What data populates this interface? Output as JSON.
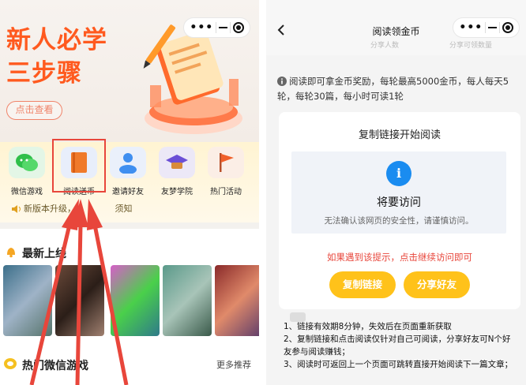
{
  "left": {
    "banner": {
      "title_line1": "新人必学",
      "title_line2": "三步骤",
      "button_label": "点击查看"
    },
    "capsule": {
      "more": "•••"
    },
    "menu": [
      {
        "label": "微信游戏",
        "icon": "wechat-icon"
      },
      {
        "label": "阅读送币",
        "icon": "book-icon"
      },
      {
        "label": "邀请好友",
        "icon": "person-icon"
      },
      {
        "label": "友梦学院",
        "icon": "graduation-cap-icon"
      },
      {
        "label": "热门活动",
        "icon": "flag-icon"
      }
    ],
    "notice": "新版本升级，　　　　　须知",
    "section_new_title": "最新上线",
    "section_games_title": "热门微信游戏",
    "more_label": "更多推荐"
  },
  "right": {
    "title": "阅读领金币",
    "capsule_more": "•••",
    "faded_left": "分享人数",
    "faded_right": "分享可领数量",
    "info": "阅读即可拿金币奖励，每轮最高5000金币，每人每天5轮，每轮30篇，每小时可读1轮",
    "card_title": "复制链接开始阅读",
    "warn_title": "将要访问",
    "warn_desc": "无法确认该网页的安全性，请谨慎访问。",
    "hint": "如果遇到该提示，点击继续访问即可",
    "copy_button": "复制链接",
    "share_button": "分享好友",
    "rules": [
      "1、链接有效期8分钟，失效后在页面重新获取",
      "2、复制链接和点击阅读仅针对自己可阅读，分享好友可N个好友参与阅读赚钱；",
      "3、阅读时可返回上一个页面可跳转直接开始阅读下一篇文章；"
    ]
  },
  "colors": {
    "brand_orange": "#ff5a1f",
    "highlight_red": "#e8463b",
    "button_yellow": "#ffc21a",
    "info_blue": "#1a8cf0"
  }
}
